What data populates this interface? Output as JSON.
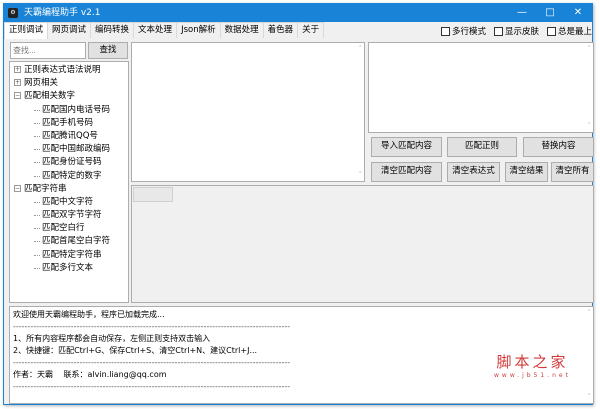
{
  "window": {
    "title": "天霸编程助手 v2.1",
    "minimize": "—",
    "maximize": "□",
    "close": "✕"
  },
  "tabs": [
    "正则调试",
    "网页调试",
    "编码转换",
    "文本处理",
    "Json解析",
    "数据处理",
    "着色器",
    "关于"
  ],
  "options": [
    "多行模式",
    "显示皮肤",
    "总是最上"
  ],
  "search": {
    "placeholder": "查找...",
    "button": "查找"
  },
  "tree": [
    {
      "label": "正则表达式语法说明",
      "expanded": false,
      "children": []
    },
    {
      "label": "网页相关",
      "expanded": false,
      "children": []
    },
    {
      "label": "匹配相关数字",
      "expanded": true,
      "children": [
        "匹配国内电话号码",
        "匹配手机号码",
        "匹配腾讯QQ号",
        "匹配中国邮政编码",
        "匹配身份证号码",
        "匹配特定的数字"
      ]
    },
    {
      "label": "匹配字符串",
      "expanded": true,
      "children": [
        "匹配中文字符",
        "匹配双字节字符",
        "匹配空白行",
        "匹配首尾空白字符",
        "匹配特定字符串",
        "匹配多行文本"
      ]
    }
  ],
  "buttons": {
    "import": "导入匹配内容",
    "match": "匹配正则",
    "replace": "替换内容",
    "clear_content": "清空匹配内容",
    "clear_expr": "清空表达式",
    "clear_result": "清空结果",
    "clear_all": "清空所有"
  },
  "log": [
    "欢迎使用天霸编程助手，程序已加载完成...",
    "------------------------------------------------------------------------------------------------",
    "1、所有内容程序都会自动保存，左侧正则支持双击输入",
    "2、快捷键：匹配Ctrl+G、保存Ctrl+S、清空Ctrl+N、建议Ctrl+J...",
    "------------------------------------------------------------------------------------------------",
    "作者：天霸　 联系：alvin.liang@qq.com",
    "------------------------------------------------------------------------------------------------"
  ],
  "watermark": {
    "title": "脚本之家",
    "url": "www.jb51.net"
  }
}
